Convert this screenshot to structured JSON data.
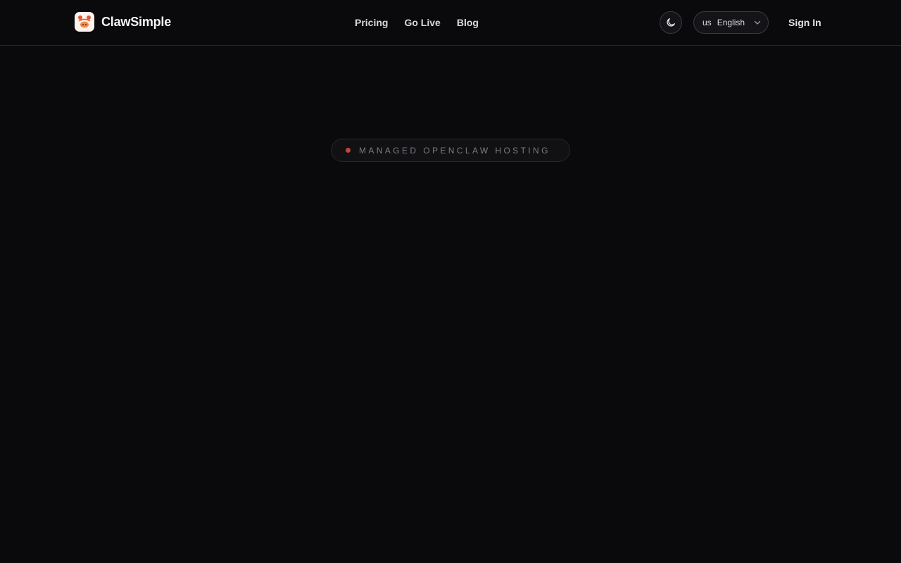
{
  "header": {
    "brand": "ClawSimple",
    "nav": [
      {
        "label": "Pricing"
      },
      {
        "label": "Go Live"
      },
      {
        "label": "Blog"
      }
    ],
    "theme_toggle_icon": "moon-icon",
    "language": {
      "flag": "us",
      "selected": "English"
    },
    "sign_in_label": "Sign In"
  },
  "hero": {
    "badge_text": "MANAGED OPENCLAW HOSTING"
  },
  "colors": {
    "background": "#0a0a0c",
    "accent_dot": "#c1463c",
    "logo_bg": "#fdf3ec",
    "logo_mark": "#e4572e"
  }
}
